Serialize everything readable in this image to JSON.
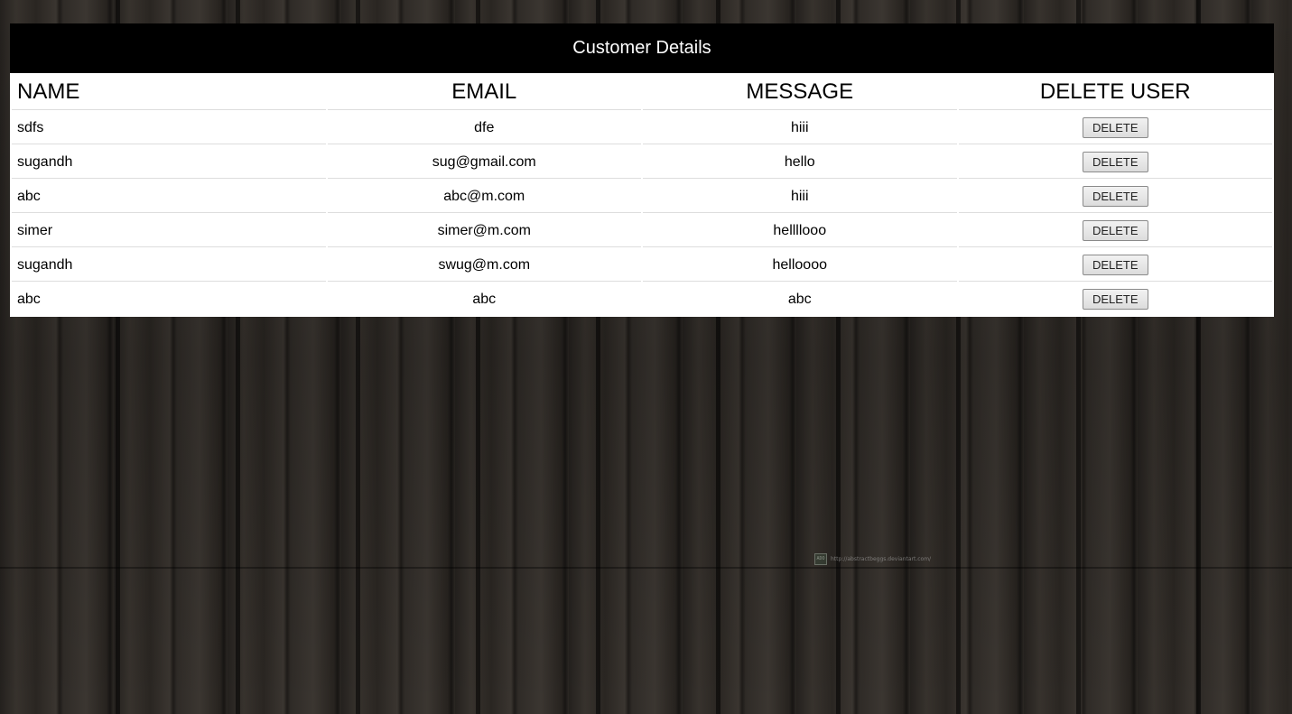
{
  "panel": {
    "title": "Customer Details"
  },
  "table": {
    "headers": {
      "name": "NAME",
      "email": "EMAIL",
      "message": "MESSAGE",
      "delete": "DELETE USER"
    },
    "rows": [
      {
        "name": "sdfs",
        "email": "dfe",
        "message": "hiii",
        "action": "DELETE"
      },
      {
        "name": "sugandh",
        "email": "sug@gmail.com",
        "message": "hello",
        "action": "DELETE"
      },
      {
        "name": "abc",
        "email": "abc@m.com",
        "message": "hiii",
        "action": "DELETE"
      },
      {
        "name": "simer",
        "email": "simer@m.com",
        "message": "hellllooo",
        "action": "DELETE"
      },
      {
        "name": "sugandh",
        "email": "swug@m.com",
        "message": "helloooo",
        "action": "DELETE"
      },
      {
        "name": "abc",
        "email": "abc",
        "message": "abc",
        "action": "DELETE"
      }
    ]
  },
  "background": {
    "watermark_logo": "ADO",
    "watermark_text": "http://abstractbeggs.deviantart.com/"
  },
  "colors": {
    "header_bg": "#000000",
    "header_text": "#ffffff",
    "table_bg": "#ffffff",
    "background": "#2d2925"
  }
}
